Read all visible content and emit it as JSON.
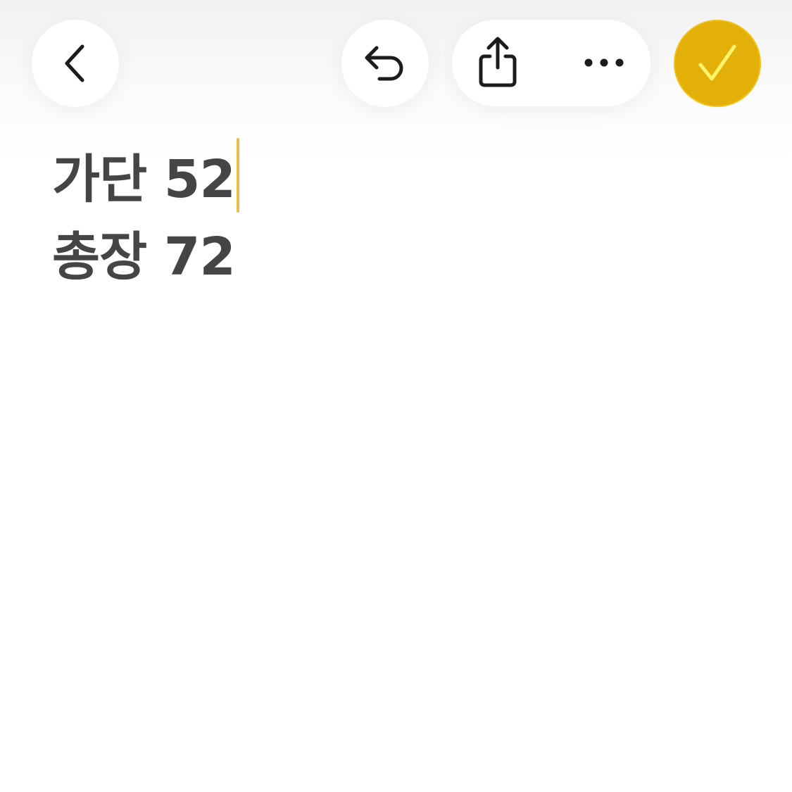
{
  "toolbar": {
    "back_icon": "chevron-left-icon",
    "undo_icon": "undo-arrow-icon",
    "share_icon": "share-icon",
    "more_icon": "ellipsis-icon",
    "done_icon": "checkmark-icon",
    "accent_color": "#E3B00A"
  },
  "note": {
    "lines": [
      "가단 52",
      "총장 72"
    ],
    "cursor_color": "#E6C04A"
  }
}
